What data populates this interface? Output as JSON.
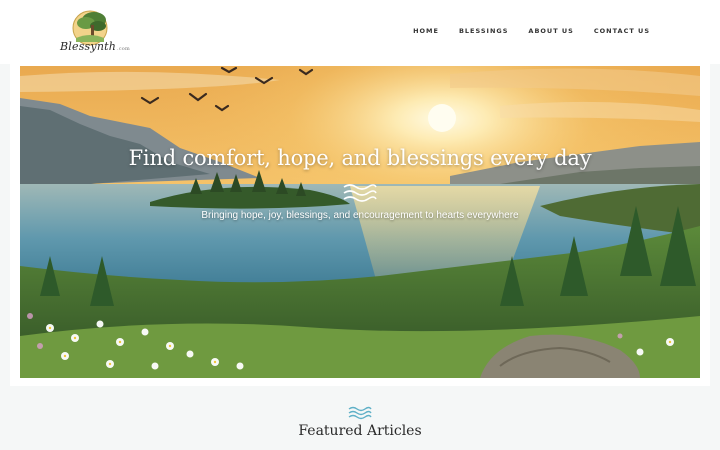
{
  "header": {
    "logo_name": "Blessynth",
    "logo_suffix": ".com",
    "nav": [
      {
        "label": "HOME"
      },
      {
        "label": "BLESSINGS"
      },
      {
        "label": "ABOUT US"
      },
      {
        "label": "CONTACT US"
      }
    ]
  },
  "hero": {
    "title": "Find comfort, hope, and blessings every day",
    "subtitle": "Bringing hope, joy, blessings, and encouragement to hearts everywhere",
    "image": "sunset-lake-landscape"
  },
  "featured": {
    "title": "Featured Articles"
  },
  "colors": {
    "accent": "#5fb0c7",
    "sky_top": "#f6c36a",
    "sun": "#fff5cf",
    "lake": "#4f8fa8",
    "forest": "#3f6b34"
  },
  "icons": [
    "tree-logo-icon",
    "wave-divider-icon"
  ]
}
